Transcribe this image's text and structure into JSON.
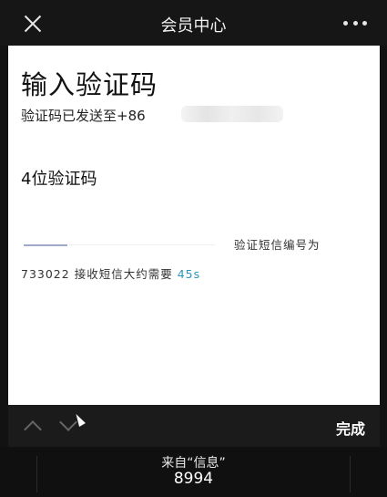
{
  "nav": {
    "title": "会员中心",
    "close_icon": "close-icon",
    "more_icon": "more-icon"
  },
  "verify": {
    "heading": "输入验证码",
    "sent_prefix": "验证码已发送至+86",
    "code_length_label": "4位验证码",
    "sms_hint_line1": "验证短信编号为",
    "sms_hint_line2_prefix": "733022 接收短信大约需要",
    "countdown": "45s",
    "accent_color": "#2b95bd"
  },
  "keyboard_bar": {
    "prev_icon": "chevron-up-icon",
    "next_icon": "chevron-down-icon",
    "done_label": "完成"
  },
  "autofill_suggestion": {
    "source": "来自“信息”",
    "code": "8994"
  }
}
